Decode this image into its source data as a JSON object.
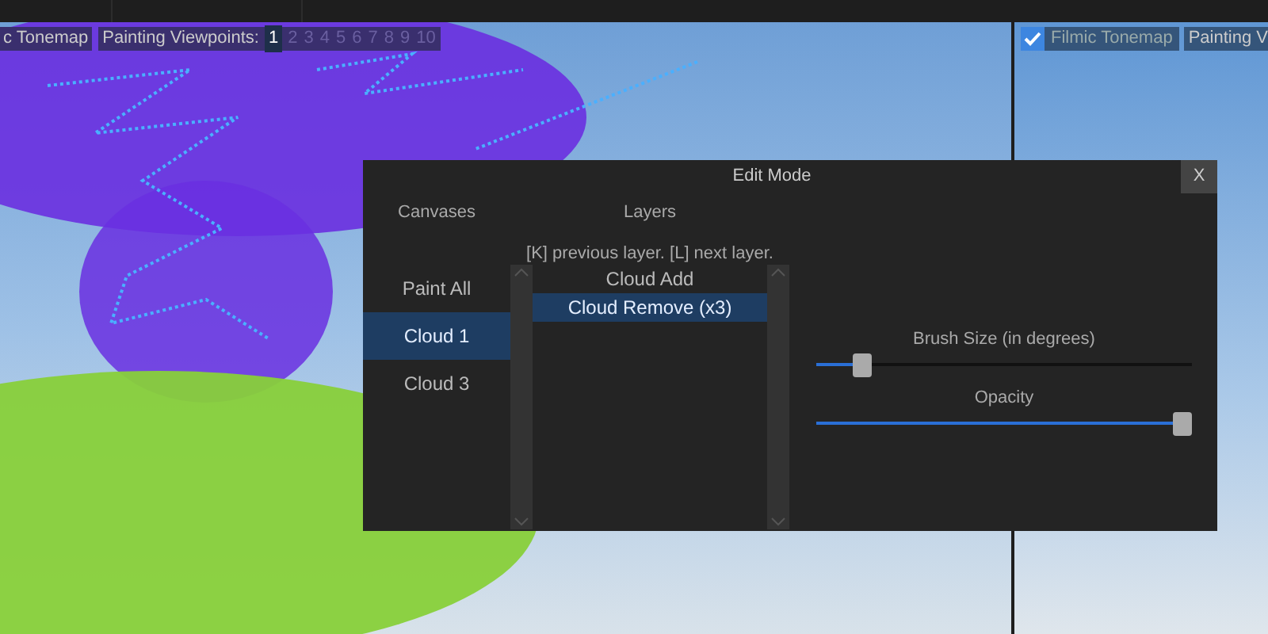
{
  "left_viewport": {
    "tonemap_label": "c Tonemap",
    "viewpoints_label": "Painting Viewpoints:",
    "viewpoints": [
      {
        "label": "1",
        "selected": true
      },
      {
        "label": "2",
        "selected": false
      },
      {
        "label": "3",
        "selected": false
      },
      {
        "label": "4",
        "selected": false
      },
      {
        "label": "5",
        "selected": false
      },
      {
        "label": "6",
        "selected": false
      },
      {
        "label": "7",
        "selected": false
      },
      {
        "label": "8",
        "selected": false
      },
      {
        "label": "9",
        "selected": false
      },
      {
        "label": "10",
        "selected": false
      }
    ]
  },
  "right_viewport": {
    "tonemap": {
      "label": "Filmic Tonemap",
      "checked": true
    },
    "viewpoints_label": "Painting V"
  },
  "dialog": {
    "title": "Edit Mode",
    "close": "X",
    "canvases": {
      "heading": "Canvases",
      "items": [
        {
          "label": "Paint All",
          "selected": false
        },
        {
          "label": "Cloud 1",
          "selected": true
        },
        {
          "label": "Cloud 3",
          "selected": false
        }
      ]
    },
    "layers": {
      "heading": "Layers",
      "hint": "[K] previous layer. [L] next layer.",
      "items": [
        {
          "label": "Cloud Add",
          "selected": false
        },
        {
          "label": "Cloud Remove (x3)",
          "selected": true
        }
      ]
    },
    "sliders": [
      {
        "label": "Brush Size (in degrees)",
        "level": 0.1
      },
      {
        "label": "Opacity",
        "level": 1.0
      }
    ]
  }
}
